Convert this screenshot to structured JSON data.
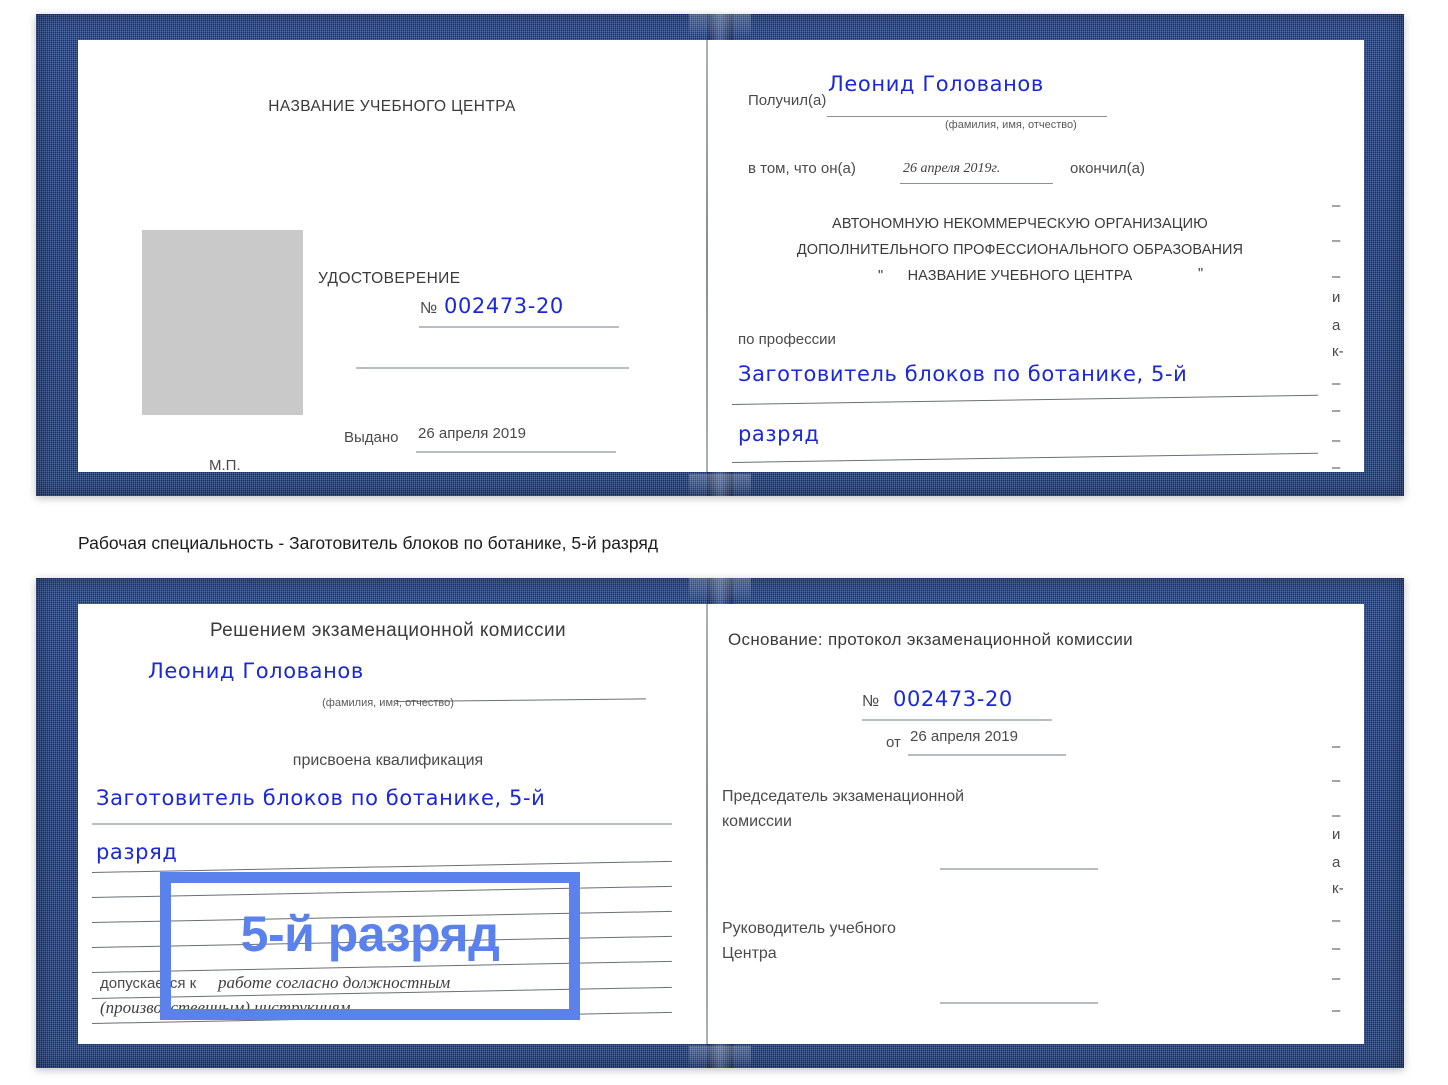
{
  "caption": "Рабочая специальность - Заготовитель блоков по ботанике, 5-й разряд",
  "highlight_badge": {
    "text": "5-й разряд",
    "border_color": "#5b82ec",
    "text_color": "#5b82ec"
  },
  "colors": {
    "cover_blue": "#22438c",
    "handwriting_blue": "#1a28d8",
    "photo_placeholder": "#c9c9c9",
    "rule_gray": "#b9bcc0",
    "body_text": "#3b3b3b"
  },
  "certificate_front": {
    "left_page": {
      "center_name": "НАЗВАНИЕ УЧЕБНОГО ЦЕНТРА",
      "doc_type": "УДОСТОВЕРЕНИЕ",
      "number_symbol": "№",
      "number_value": "002473-20",
      "issued_label": "Выдано",
      "issued_value": "26 апреля 2019",
      "stamp_label": "М.П."
    },
    "right_page": {
      "received_label": "Получил(а)",
      "received_value": "Леонид Голованов",
      "received_hint": "(фамилия, имя, отчество)",
      "that_he_label": "в том, что он(а)",
      "that_he_value": "26 апреля 2019г.",
      "finished_label": "окончил(а)",
      "org_line1": "АВТОНОМНУЮ НЕКОММЕРЧЕСКУЮ ОРГАНИЗАЦИЮ",
      "org_line2": "ДОПОЛНИТЕЛЬНОГО ПРОФЕССИОНАЛЬНОГО ОБРАЗОВАНИЯ",
      "org_quote_open": "\"",
      "org_line3": "НАЗВАНИЕ УЧЕБНОГО ЦЕНТРА",
      "org_quote_close": "\"",
      "profession_label": "по профессии",
      "profession_value_line1": "Заготовитель блоков по ботанике, 5-й",
      "profession_value_line2": "разряд",
      "edge_glyphs": [
        "–",
        "–",
        "–",
        "и",
        "а",
        "к-",
        "–",
        "–",
        "–",
        "–"
      ]
    }
  },
  "certificate_back": {
    "left_page": {
      "decision_title": "Решением экзаменационной комиссии",
      "name_value": "Леонид Голованов",
      "name_hint": "(фамилия, имя, отчество)",
      "qualification_label": "присвоена квалификация",
      "qualification_line1": "Заготовитель блоков по ботанике, 5-й",
      "qualification_line2": "разряд",
      "allowed_label": "допускается к",
      "allowed_value_line1": "работе согласно должностным",
      "allowed_value_line2": "(производственным) инструкциям"
    },
    "right_page": {
      "basis_label": "Основание: протокол экзаменационной комиссии",
      "number_symbol": "№",
      "number_value": "002473-20",
      "from_label": "от",
      "from_value": "26 апреля 2019",
      "chairman_line1": "Председатель экзаменационной",
      "chairman_line2": "комиссии",
      "head_line1": "Руководитель учебного",
      "head_line2": "Центра",
      "edge_glyphs": [
        "–",
        "–",
        "–",
        "и",
        "а",
        "к-",
        "–",
        "–",
        "–",
        "–"
      ]
    }
  }
}
